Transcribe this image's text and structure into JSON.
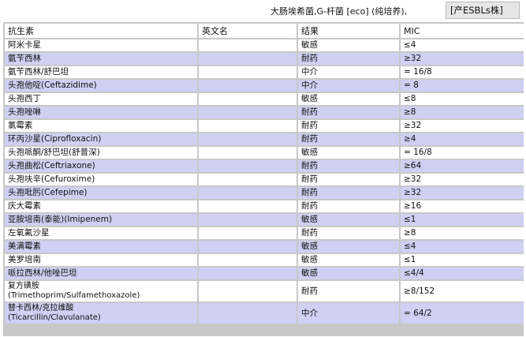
{
  "header": {
    "organism": "大肠埃希菌,G-杆菌 [eco] (纯培养),",
    "esbl_tag": "[产ESBLs株]"
  },
  "table": {
    "columns": [
      "抗生素",
      "英文名",
      "结果",
      "MIC"
    ],
    "rows": [
      {
        "drug": "阿米卡星",
        "english": "",
        "result": "敏感",
        "mic": "≤4"
      },
      {
        "drug": "氨苄西林",
        "english": "",
        "result": "耐药",
        "mic": "≥32"
      },
      {
        "drug": "氨苄西林/舒巴坦",
        "english": "",
        "result": "中介",
        "mic": "= 16/8"
      },
      {
        "drug": "头孢他啶(Ceftazidime)",
        "english": "",
        "result": "中介",
        "mic": "= 8"
      },
      {
        "drug": "头孢西丁",
        "english": "",
        "result": "敏感",
        "mic": "≤8"
      },
      {
        "drug": "头孢唑啉",
        "english": "",
        "result": "耐药",
        "mic": "≥8"
      },
      {
        "drug": "氯霉素",
        "english": "",
        "result": "耐药",
        "mic": "≥32"
      },
      {
        "drug": "环丙沙星(Ciprofloxacin)",
        "english": "",
        "result": "耐药",
        "mic": "≥4"
      },
      {
        "drug": "头孢哌酮/舒巴坦(舒普深)",
        "english": "",
        "result": "敏感",
        "mic": "= 16/8"
      },
      {
        "drug": "头孢曲松(Ceftriaxone)",
        "english": "",
        "result": "耐药",
        "mic": "≥64"
      },
      {
        "drug": "头孢呋辛(Cefuroxime)",
        "english": "",
        "result": "耐药",
        "mic": "≥32"
      },
      {
        "drug": "头孢吡肟(Cefepime)",
        "english": "",
        "result": "耐药",
        "mic": "≥32"
      },
      {
        "drug": "庆大霉素",
        "english": "",
        "result": "耐药",
        "mic": "≥16"
      },
      {
        "drug": "亚胺培南(泰能)(Imipenem)",
        "english": "",
        "result": "敏感",
        "mic": "≤1"
      },
      {
        "drug": "左氧氟沙星",
        "english": "",
        "result": "耐药",
        "mic": "≥8"
      },
      {
        "drug": "美满霉素",
        "english": "",
        "result": "敏感",
        "mic": "≤4"
      },
      {
        "drug": "美罗培南",
        "english": "",
        "result": "敏感",
        "mic": "≤1"
      },
      {
        "drug": "哌拉西林/他唑巴坦",
        "english": "",
        "result": "敏感",
        "mic": "≤4/4"
      },
      {
        "drug": "复方磺胺\n(Trimethoprim/Sulfamethoxazole)",
        "english": "",
        "result": "耐药",
        "mic": "≥8/152"
      },
      {
        "drug": "替卡西林/克拉维酸\n(Ticarcillin/Clavulanate)",
        "english": "",
        "result": "中介",
        "mic": "= 64/2"
      }
    ]
  },
  "colors": {
    "band": "#cfd0f2",
    "grid": "#c8c8c8",
    "header_bg": "#ffffff"
  }
}
